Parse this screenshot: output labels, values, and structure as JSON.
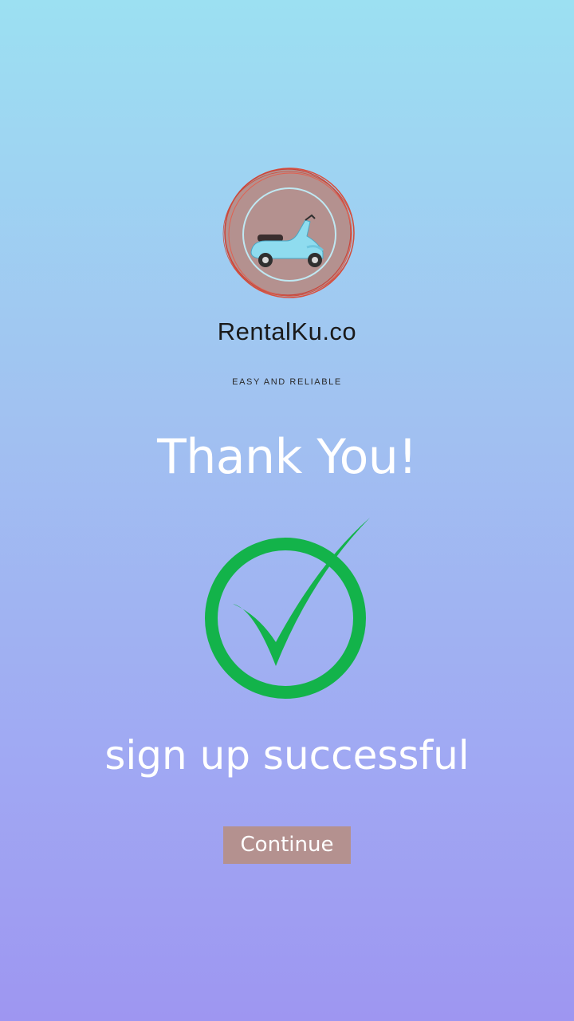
{
  "brand": {
    "logo_icon": "scooter-icon",
    "name": "RentalKu.co",
    "tagline": "EASY AND RELIABLE"
  },
  "main": {
    "heading": "Thank You!",
    "status_icon": "check-circle-icon",
    "message": "sign up successful",
    "continue_label": "Continue"
  },
  "colors": {
    "background_top": "#9ce0f2",
    "background_bottom": "#9e96f1",
    "logo_circle": "#b4918f",
    "logo_scribble": "#d9503f",
    "check_green": "#13b34a",
    "button": "#b4918f",
    "text_light": "#ffffff"
  }
}
